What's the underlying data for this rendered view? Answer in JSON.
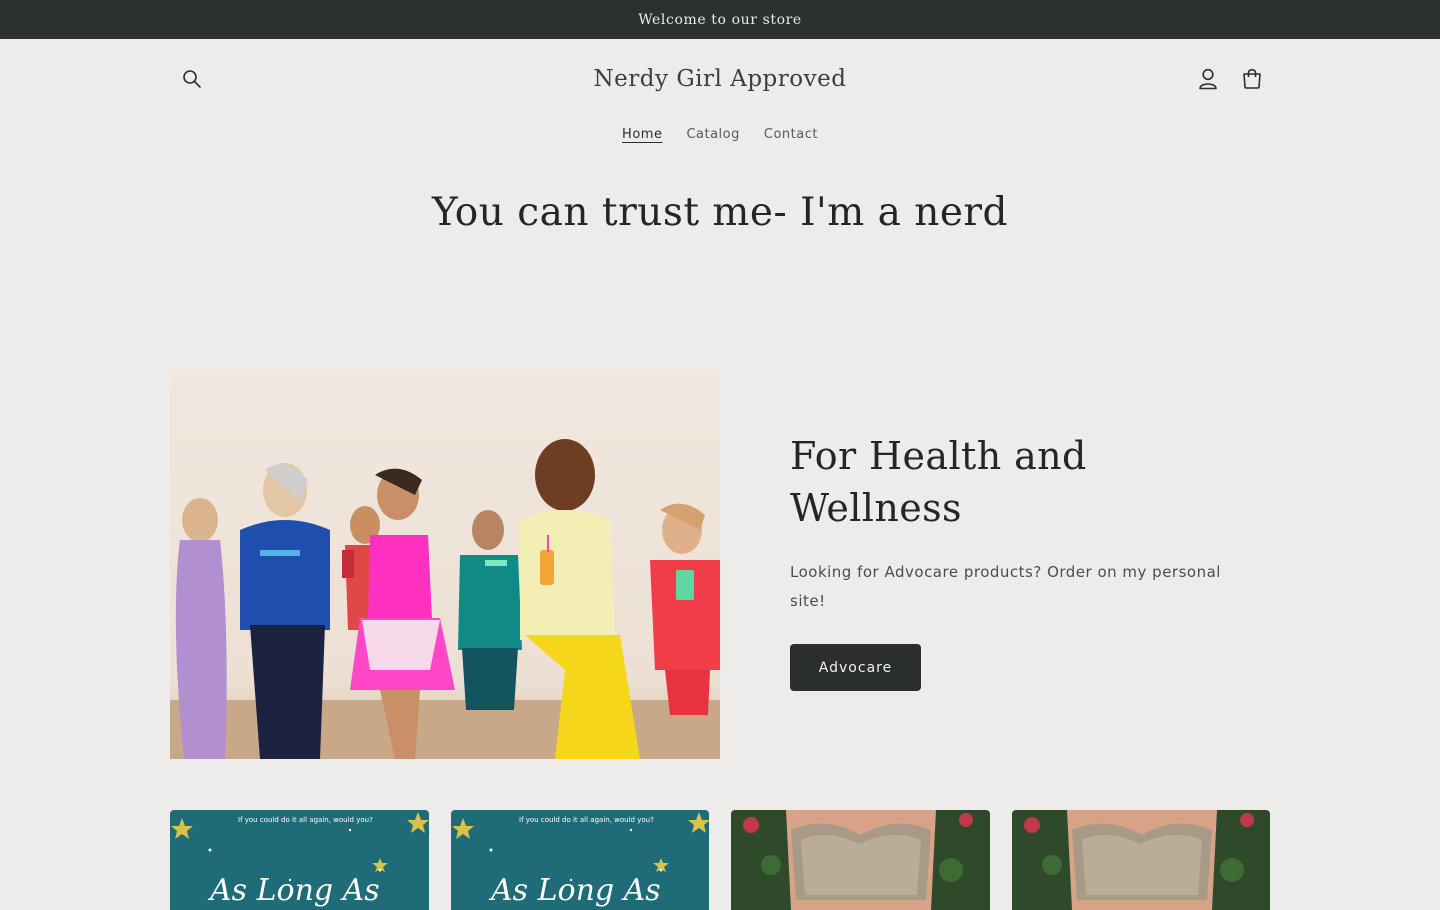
{
  "announcement": {
    "text": "Welcome to our store"
  },
  "header": {
    "store_name": "Nerdy Girl Approved",
    "icons": {
      "search": "search-icon",
      "account": "account-icon",
      "cart": "cart-icon"
    }
  },
  "nav": {
    "items": [
      {
        "label": "Home",
        "active": true
      },
      {
        "label": "Catalog",
        "active": false
      },
      {
        "label": "Contact",
        "active": false
      }
    ]
  },
  "hero": {
    "title": "You can trust me- I'm a nerd"
  },
  "feature": {
    "heading": "For Health and Wellness",
    "body": "Looking for Advocare products? Order on my personal site!",
    "button_label": "Advocare"
  },
  "products": {
    "cards": [
      {
        "cover_text": "If you could do it all again, would you?",
        "cover_title": "As Long As"
      },
      {
        "cover_text": "If you could do it all again, would you?",
        "cover_title": "As Long As"
      },
      {
        "image": "sequined-dress-photo"
      },
      {
        "image": "sequined-dress-photo"
      }
    ]
  },
  "colors": {
    "background": "#eeecea",
    "announcement_bg": "#2c302e",
    "button_bg": "#2a2e2c",
    "book_cover_teal": "#1f6b78"
  }
}
